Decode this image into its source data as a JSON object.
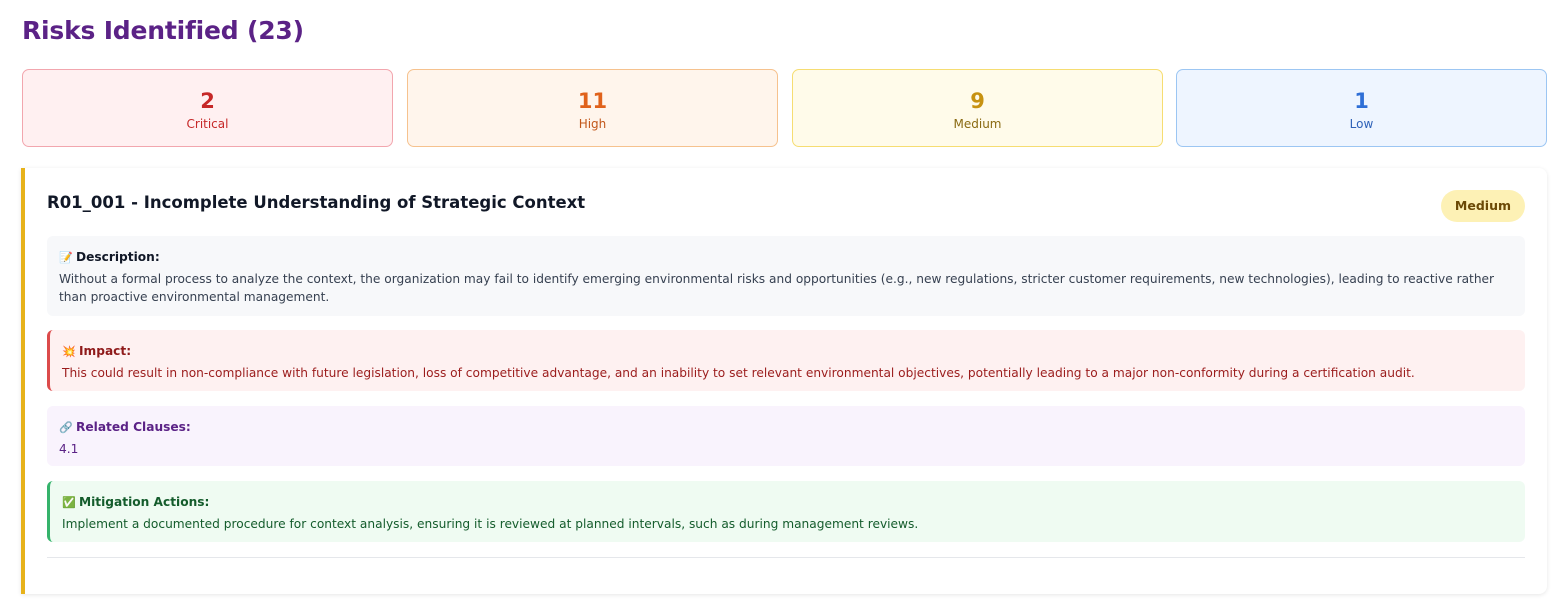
{
  "header": {
    "title": "Risks Identified (23)"
  },
  "summary": [
    {
      "count": "2",
      "label": "Critical"
    },
    {
      "count": "11",
      "label": "High"
    },
    {
      "count": "9",
      "label": "Medium"
    },
    {
      "count": "1",
      "label": "Low"
    }
  ],
  "risk": {
    "title": "R01_001 - Incomplete Understanding of Strategic Context",
    "severity": "Medium",
    "accent_color": "#e7b21a",
    "description": {
      "icon": "memo-icon",
      "label": "Description:",
      "text": "Without a formal process to analyze the context, the organization may fail to identify emerging environmental risks and opportunities (e.g., new regulations, stricter customer requirements, new technologies), leading to reactive rather than proactive environmental management."
    },
    "impact": {
      "icon": "collision-icon",
      "label": "Impact:",
      "text": "This could result in non-compliance with future legislation, loss of competitive advantage, and an inability to set relevant environmental objectives, potentially leading to a major non-conformity during a certification audit."
    },
    "clauses": {
      "icon": "link-icon",
      "label": "Related Clauses:",
      "text": "4.1"
    },
    "mitigation": {
      "icon": "check-box-icon",
      "label": "Mitigation Actions:",
      "text": "Implement a documented procedure for context analysis, ensuring it is reviewed at planned intervals, such as during management reviews."
    }
  }
}
